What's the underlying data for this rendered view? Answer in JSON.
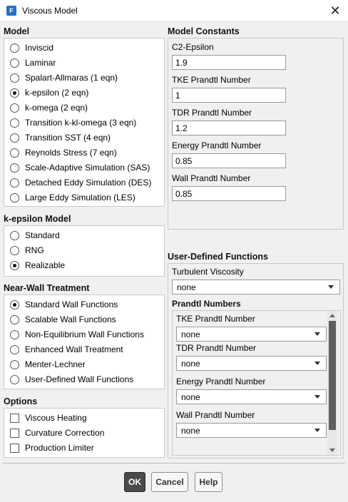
{
  "window": {
    "title": "Viscous Model",
    "app_icon_letter": "F",
    "close_glyph": "✕"
  },
  "model": {
    "title": "Model",
    "options": [
      "Inviscid",
      "Laminar",
      "Spalart-Allmaras (1 eqn)",
      "k-epsilon (2 eqn)",
      "k-omega (2 eqn)",
      "Transition k-kl-omega (3 eqn)",
      "Transition SST (4 eqn)",
      "Reynolds Stress (7 eqn)",
      "Scale-Adaptive Simulation (SAS)",
      "Detached Eddy Simulation (DES)",
      "Large Eddy Simulation (LES)"
    ],
    "selected": "k-epsilon (2 eqn)"
  },
  "keps_model": {
    "title": "k-epsilon Model",
    "options": [
      "Standard",
      "RNG",
      "Realizable"
    ],
    "selected": "Realizable"
  },
  "near_wall": {
    "title": "Near-Wall Treatment",
    "options": [
      "Standard Wall Functions",
      "Scalable Wall Functions",
      "Non-Equilibrium Wall Functions",
      "Enhanced Wall Treatment",
      "Menter-Lechner",
      "User-Defined Wall Functions"
    ],
    "selected": "Standard Wall Functions"
  },
  "options": {
    "title": "Options",
    "items": [
      {
        "label": "Viscous Heating",
        "checked": false
      },
      {
        "label": "Curvature Correction",
        "checked": false
      },
      {
        "label": "Production Limiter",
        "checked": false
      }
    ]
  },
  "constants": {
    "title": "Model Constants",
    "fields": [
      {
        "label": "C2-Epsilon",
        "value": "1.9"
      },
      {
        "label": "TKE Prandtl Number",
        "value": "1"
      },
      {
        "label": "TDR Prandtl Number",
        "value": "1.2"
      },
      {
        "label": "Energy Prandtl Number",
        "value": "0.85"
      },
      {
        "label": "Wall Prandtl Number",
        "value": "0.85"
      }
    ]
  },
  "udf": {
    "title": "User-Defined Functions",
    "turb_visc_label": "Turbulent Viscosity",
    "turb_visc_value": "none",
    "prandtl_title": "Prandtl Numbers",
    "prandtl_fields": [
      {
        "label": "TKE Prandtl Number",
        "value": "none"
      },
      {
        "label": "TDR Prandtl Number",
        "value": "none"
      },
      {
        "label": "Energy Prandtl Number",
        "value": "none"
      },
      {
        "label": "Wall Prandtl Number",
        "value": "none"
      }
    ],
    "scroll_fraction_visible": 0.88
  },
  "buttons": {
    "ok": "OK",
    "cancel": "Cancel",
    "help": "Help"
  },
  "colors": {
    "ok_button_bg": "#4a4a4a",
    "app_icon_bg": "#1f6fd0",
    "scroll_thumb": "#5f5f5f"
  }
}
